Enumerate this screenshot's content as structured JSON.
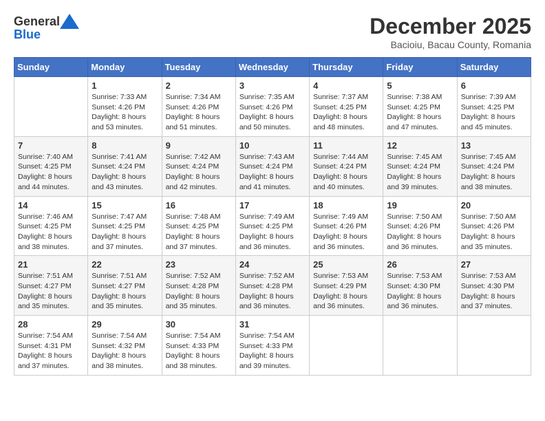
{
  "header": {
    "logo_general": "General",
    "logo_blue": "Blue",
    "month_title": "December 2025",
    "location": "Bacioiu, Bacau County, Romania"
  },
  "days_of_week": [
    "Sunday",
    "Monday",
    "Tuesday",
    "Wednesday",
    "Thursday",
    "Friday",
    "Saturday"
  ],
  "weeks": [
    [
      {
        "day": "",
        "info": ""
      },
      {
        "day": "1",
        "info": "Sunrise: 7:33 AM\nSunset: 4:26 PM\nDaylight: 8 hours\nand 53 minutes."
      },
      {
        "day": "2",
        "info": "Sunrise: 7:34 AM\nSunset: 4:26 PM\nDaylight: 8 hours\nand 51 minutes."
      },
      {
        "day": "3",
        "info": "Sunrise: 7:35 AM\nSunset: 4:26 PM\nDaylight: 8 hours\nand 50 minutes."
      },
      {
        "day": "4",
        "info": "Sunrise: 7:37 AM\nSunset: 4:25 PM\nDaylight: 8 hours\nand 48 minutes."
      },
      {
        "day": "5",
        "info": "Sunrise: 7:38 AM\nSunset: 4:25 PM\nDaylight: 8 hours\nand 47 minutes."
      },
      {
        "day": "6",
        "info": "Sunrise: 7:39 AM\nSunset: 4:25 PM\nDaylight: 8 hours\nand 45 minutes."
      }
    ],
    [
      {
        "day": "7",
        "info": "Sunrise: 7:40 AM\nSunset: 4:25 PM\nDaylight: 8 hours\nand 44 minutes."
      },
      {
        "day": "8",
        "info": "Sunrise: 7:41 AM\nSunset: 4:24 PM\nDaylight: 8 hours\nand 43 minutes."
      },
      {
        "day": "9",
        "info": "Sunrise: 7:42 AM\nSunset: 4:24 PM\nDaylight: 8 hours\nand 42 minutes."
      },
      {
        "day": "10",
        "info": "Sunrise: 7:43 AM\nSunset: 4:24 PM\nDaylight: 8 hours\nand 41 minutes."
      },
      {
        "day": "11",
        "info": "Sunrise: 7:44 AM\nSunset: 4:24 PM\nDaylight: 8 hours\nand 40 minutes."
      },
      {
        "day": "12",
        "info": "Sunrise: 7:45 AM\nSunset: 4:24 PM\nDaylight: 8 hours\nand 39 minutes."
      },
      {
        "day": "13",
        "info": "Sunrise: 7:45 AM\nSunset: 4:24 PM\nDaylight: 8 hours\nand 38 minutes."
      }
    ],
    [
      {
        "day": "14",
        "info": "Sunrise: 7:46 AM\nSunset: 4:25 PM\nDaylight: 8 hours\nand 38 minutes."
      },
      {
        "day": "15",
        "info": "Sunrise: 7:47 AM\nSunset: 4:25 PM\nDaylight: 8 hours\nand 37 minutes."
      },
      {
        "day": "16",
        "info": "Sunrise: 7:48 AM\nSunset: 4:25 PM\nDaylight: 8 hours\nand 37 minutes."
      },
      {
        "day": "17",
        "info": "Sunrise: 7:49 AM\nSunset: 4:25 PM\nDaylight: 8 hours\nand 36 minutes."
      },
      {
        "day": "18",
        "info": "Sunrise: 7:49 AM\nSunset: 4:26 PM\nDaylight: 8 hours\nand 36 minutes."
      },
      {
        "day": "19",
        "info": "Sunrise: 7:50 AM\nSunset: 4:26 PM\nDaylight: 8 hours\nand 36 minutes."
      },
      {
        "day": "20",
        "info": "Sunrise: 7:50 AM\nSunset: 4:26 PM\nDaylight: 8 hours\nand 35 minutes."
      }
    ],
    [
      {
        "day": "21",
        "info": "Sunrise: 7:51 AM\nSunset: 4:27 PM\nDaylight: 8 hours\nand 35 minutes."
      },
      {
        "day": "22",
        "info": "Sunrise: 7:51 AM\nSunset: 4:27 PM\nDaylight: 8 hours\nand 35 minutes."
      },
      {
        "day": "23",
        "info": "Sunrise: 7:52 AM\nSunset: 4:28 PM\nDaylight: 8 hours\nand 35 minutes."
      },
      {
        "day": "24",
        "info": "Sunrise: 7:52 AM\nSunset: 4:28 PM\nDaylight: 8 hours\nand 36 minutes."
      },
      {
        "day": "25",
        "info": "Sunrise: 7:53 AM\nSunset: 4:29 PM\nDaylight: 8 hours\nand 36 minutes."
      },
      {
        "day": "26",
        "info": "Sunrise: 7:53 AM\nSunset: 4:30 PM\nDaylight: 8 hours\nand 36 minutes."
      },
      {
        "day": "27",
        "info": "Sunrise: 7:53 AM\nSunset: 4:30 PM\nDaylight: 8 hours\nand 37 minutes."
      }
    ],
    [
      {
        "day": "28",
        "info": "Sunrise: 7:54 AM\nSunset: 4:31 PM\nDaylight: 8 hours\nand 37 minutes."
      },
      {
        "day": "29",
        "info": "Sunrise: 7:54 AM\nSunset: 4:32 PM\nDaylight: 8 hours\nand 38 minutes."
      },
      {
        "day": "30",
        "info": "Sunrise: 7:54 AM\nSunset: 4:33 PM\nDaylight: 8 hours\nand 38 minutes."
      },
      {
        "day": "31",
        "info": "Sunrise: 7:54 AM\nSunset: 4:33 PM\nDaylight: 8 hours\nand 39 minutes."
      },
      {
        "day": "",
        "info": ""
      },
      {
        "day": "",
        "info": ""
      },
      {
        "day": "",
        "info": ""
      }
    ]
  ]
}
